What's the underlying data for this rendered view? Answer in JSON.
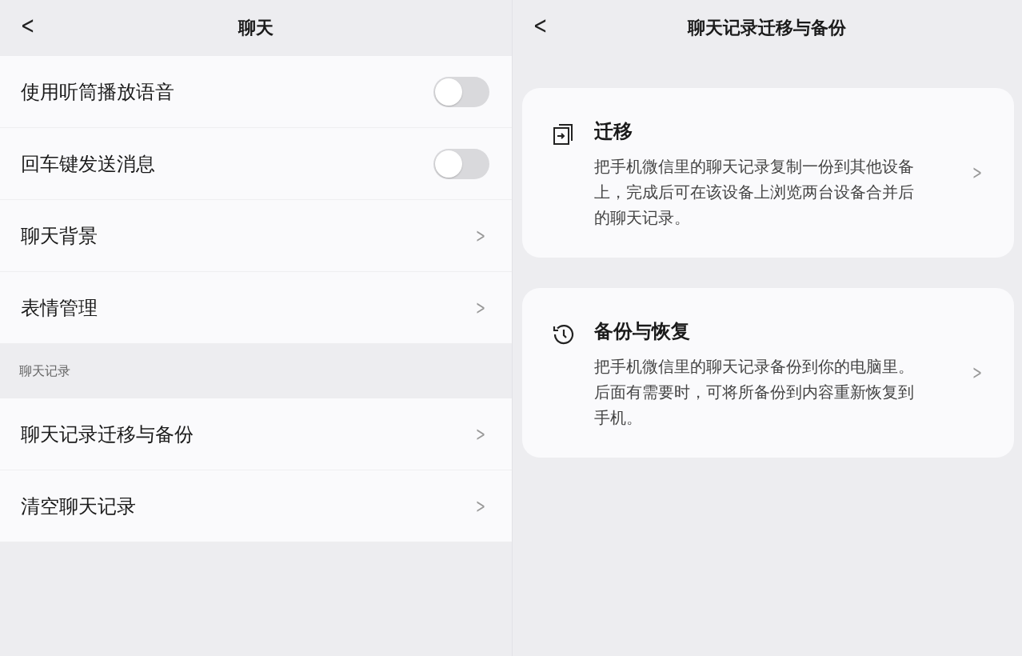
{
  "left_panel": {
    "back": "<",
    "title": "聊天",
    "groups": [
      {
        "rows": [
          {
            "kind": "toggle",
            "label": "使用听筒播放语音",
            "on": false
          },
          {
            "kind": "toggle",
            "label": "回车键发送消息",
            "on": false
          },
          {
            "kind": "link",
            "label": "聊天背景",
            "chevron": ">"
          },
          {
            "kind": "link",
            "label": "表情管理",
            "chevron": ">"
          }
        ]
      },
      {
        "label": "聊天记录",
        "rows": [
          {
            "kind": "link",
            "label": "聊天记录迁移与备份",
            "chevron": ">"
          },
          {
            "kind": "link",
            "label": "清空聊天记录",
            "chevron": ">"
          }
        ]
      }
    ]
  },
  "right_panel": {
    "back": "<",
    "title": "聊天记录迁移与备份",
    "cards": [
      {
        "kind": "migrate",
        "title": "迁移",
        "description": "把手机微信里的聊天记录复制一份到其他设备上，完成后可在该设备上浏览两台设备合并后的聊天记录。",
        "chevron": ">"
      },
      {
        "kind": "backup",
        "title": "备份与恢复",
        "description": "把手机微信里的聊天记录备份到你的电脑里。后面有需要时，可将所备份到内容重新恢复到手机。",
        "chevron": ">"
      }
    ]
  }
}
